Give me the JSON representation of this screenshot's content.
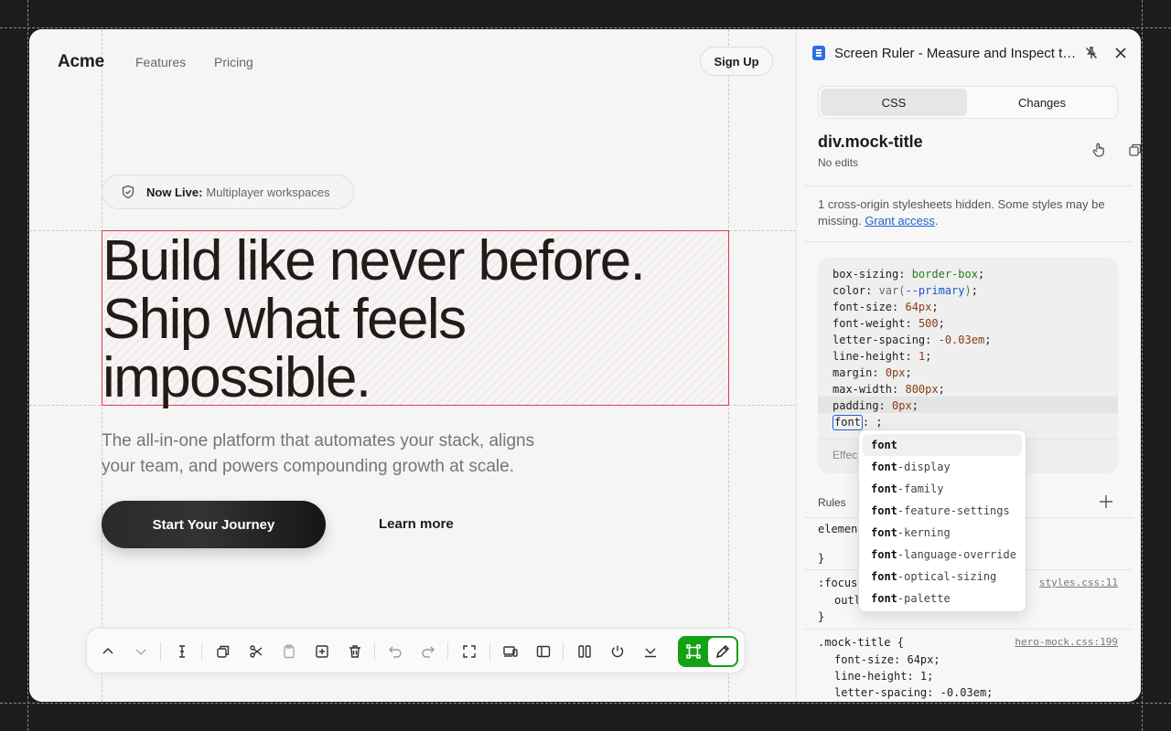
{
  "site": {
    "logo": "Acme",
    "nav": [
      "Features",
      "Pricing"
    ],
    "signup": "Sign Up",
    "badge_bold": "Now Live:",
    "badge_text": "Multiplayer workspaces",
    "hero_lines": [
      "Build like never before.",
      "Ship what feels",
      "impossible."
    ],
    "subtitle_lines": [
      "The all-in-one platform that automates your stack, aligns",
      "your team, and powers compounding growth at scale."
    ],
    "cta": "Start Your Journey",
    "learn_more": "Learn more"
  },
  "toolbar": {
    "icons": [
      "chevron-up-icon",
      "chevron-down-icon",
      "text-cursor-icon",
      "duplicate-icon",
      "scissors-icon",
      "clipboard-icon",
      "add-box-icon",
      "trash-icon",
      "undo-icon",
      "redo-icon",
      "fullscreen-icon",
      "devices-icon",
      "sidebar-icon",
      "columns-icon",
      "power-icon",
      "collapse-icon",
      "select-frame-icon",
      "pencil-icon"
    ],
    "accent": "#14a114"
  },
  "panel": {
    "title": "Screen Ruler - Measure and Inspect the Web",
    "tabs": [
      "CSS",
      "Changes"
    ],
    "active_tab": "CSS",
    "element": "div.mock-title",
    "element_status": "No edits",
    "note": "1 cross-origin stylesheets hidden. Some styles may be missing.",
    "note_link": "Grant access",
    "code": [
      {
        "prop": "box-sizing",
        "val": "border-box"
      },
      {
        "prop": "color",
        "val": "var(--primary)"
      },
      {
        "prop": "font-size",
        "val": "64px"
      },
      {
        "prop": "font-weight",
        "val": "500"
      },
      {
        "prop": "letter-spacing",
        "val": "-0.03em"
      },
      {
        "prop": "line-height",
        "val": "1"
      },
      {
        "prop": "margin",
        "val": "0px"
      },
      {
        "prop": "max-width",
        "val": "800px"
      },
      {
        "prop": "padding",
        "val": "0px"
      }
    ],
    "editing_prop": "font",
    "effective_label": "Effec",
    "autocomplete": [
      "font",
      "font-display",
      "font-family",
      "font-feature-settings",
      "font-kerning",
      "font-language-override",
      "font-optical-sizing",
      "font-palette"
    ],
    "rules_label": "Rules",
    "rules": {
      "element_selector": "element",
      "focus_selector": ":focus",
      "focus_prop": "outl",
      "focus_src": "styles.css:11",
      "mock_selector": ".mock-title {",
      "mock_src": "hero-mock.css:199",
      "mock_props": [
        "font-size: 64px;",
        "line-height: 1;",
        "letter-spacing: -0.03em;"
      ]
    }
  }
}
